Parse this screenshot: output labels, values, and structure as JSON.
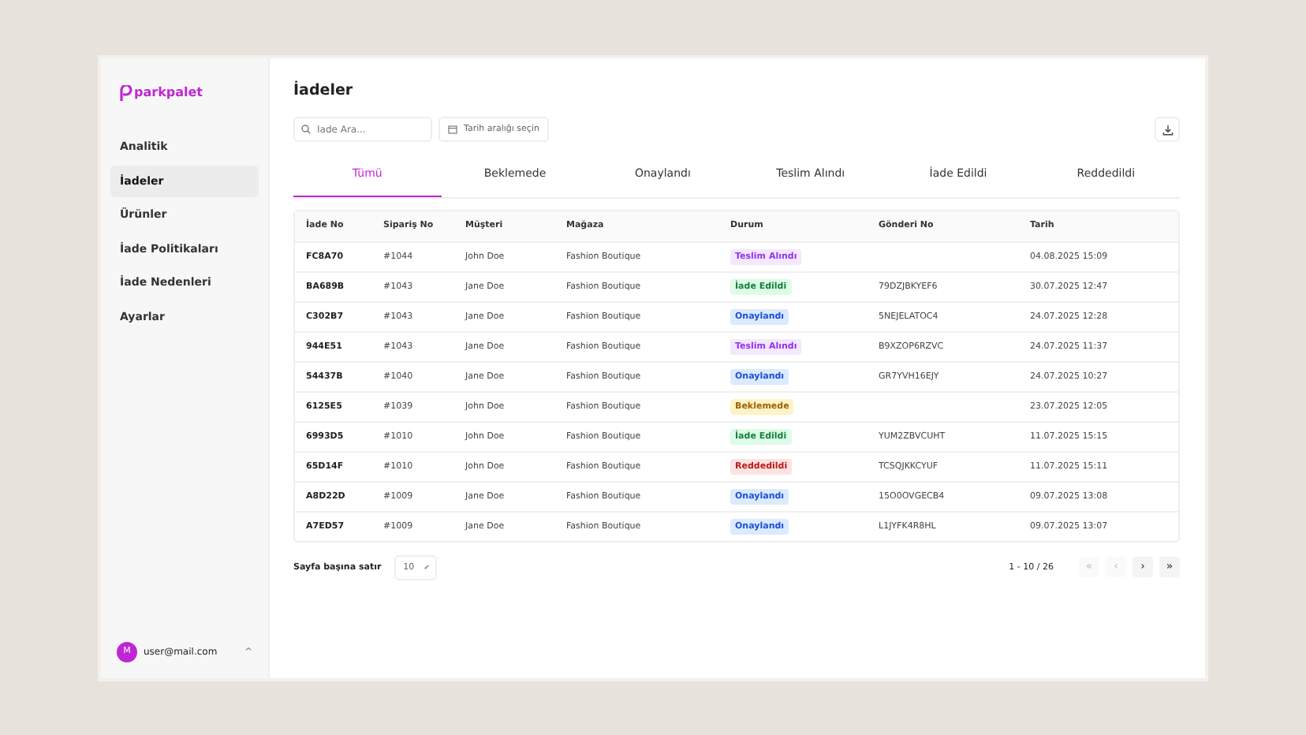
{
  "brand": "parkpalet",
  "sidebar": {
    "items": [
      {
        "label": "Analitik",
        "selected": false
      },
      {
        "label": "İadeler",
        "selected": true
      },
      {
        "label": "Ürünler",
        "selected": false
      },
      {
        "label": "İade Politikaları",
        "selected": false
      },
      {
        "label": "İade Nedenleri",
        "selected": false
      },
      {
        "label": "Ayarlar",
        "selected": false
      }
    ],
    "user": {
      "initial": "M",
      "email": "user@mail.com",
      "caret": "^"
    }
  },
  "page_title": "İadeler",
  "search": {
    "placeholder": "İade Ara..."
  },
  "date_filter": {
    "label": "Tarih aralığı seçin"
  },
  "tabs": [
    {
      "label": "Tümü",
      "selected": true
    },
    {
      "label": "Beklemede",
      "selected": false
    },
    {
      "label": "Onaylandı",
      "selected": false
    },
    {
      "label": "Teslim Alındı",
      "selected": false
    },
    {
      "label": "İade Edildi",
      "selected": false
    },
    {
      "label": "Reddedildi",
      "selected": false
    }
  ],
  "table": {
    "columns": [
      "İade No",
      "Sipariş No",
      "Müşteri",
      "Mağaza",
      "Durum",
      "Gönderi No",
      "Tarih"
    ],
    "rows": [
      {
        "id": "FC8A70",
        "order": "#1044",
        "customer": "John Doe",
        "store": "Fashion Boutique",
        "status": {
          "label": "Teslim Alındı",
          "kind": "received"
        },
        "shipment": "",
        "date": "04.08.2025 15:09"
      },
      {
        "id": "BA689B",
        "order": "#1043",
        "customer": "Jane Doe",
        "store": "Fashion Boutique",
        "status": {
          "label": "İade Edildi",
          "kind": "refunded"
        },
        "shipment": "79DZJBKYEF6",
        "date": "30.07.2025 12:47"
      },
      {
        "id": "C302B7",
        "order": "#1043",
        "customer": "Jane Doe",
        "store": "Fashion Boutique",
        "status": {
          "label": "Onaylandı",
          "kind": "approved"
        },
        "shipment": "5NEJELATOC4",
        "date": "24.07.2025 12:28"
      },
      {
        "id": "944E51",
        "order": "#1043",
        "customer": "Jane Doe",
        "store": "Fashion Boutique",
        "status": {
          "label": "Teslim Alındı",
          "kind": "received"
        },
        "shipment": "B9XZOP6RZVC",
        "date": "24.07.2025 11:37"
      },
      {
        "id": "54437B",
        "order": "#1040",
        "customer": "Jane Doe",
        "store": "Fashion Boutique",
        "status": {
          "label": "Onaylandı",
          "kind": "approved"
        },
        "shipment": "GR7YVH16EJY",
        "date": "24.07.2025 10:27"
      },
      {
        "id": "6125E5",
        "order": "#1039",
        "customer": "John Doe",
        "store": "Fashion Boutique",
        "status": {
          "label": "Beklemede",
          "kind": "pending"
        },
        "shipment": "",
        "date": "23.07.2025 12:05"
      },
      {
        "id": "6993D5",
        "order": "#1010",
        "customer": "John Doe",
        "store": "Fashion Boutique",
        "status": {
          "label": "İade Edildi",
          "kind": "refunded"
        },
        "shipment": "YUM2ZBVCUHT",
        "date": "11.07.2025 15:15"
      },
      {
        "id": "65D14F",
        "order": "#1010",
        "customer": "John Doe",
        "store": "Fashion Boutique",
        "status": {
          "label": "Reddedildi",
          "kind": "rejected"
        },
        "shipment": "TCSQJKKCYUF",
        "date": "11.07.2025 15:11"
      },
      {
        "id": "A8D22D",
        "order": "#1009",
        "customer": "Jane Doe",
        "store": "Fashion Boutique",
        "status": {
          "label": "Onaylandı",
          "kind": "approved"
        },
        "shipment": "15O0OVGECB4",
        "date": "09.07.2025 13:08"
      },
      {
        "id": "A7ED57",
        "order": "#1009",
        "customer": "Jane Doe",
        "store": "Fashion Boutique",
        "status": {
          "label": "Onaylandı",
          "kind": "approved"
        },
        "shipment": "L1JYFK4R8HL",
        "date": "09.07.2025 13:07"
      }
    ]
  },
  "rows_per_page": {
    "label": "Sayfa başına satır",
    "value": "10"
  },
  "pagination": {
    "range": "1 - 10 / 26",
    "buttons": [
      {
        "label": "«",
        "disabled": true
      },
      {
        "label": "‹",
        "disabled": true
      },
      {
        "label": "›",
        "disabled": false
      },
      {
        "label": "»",
        "disabled": false
      }
    ]
  }
}
